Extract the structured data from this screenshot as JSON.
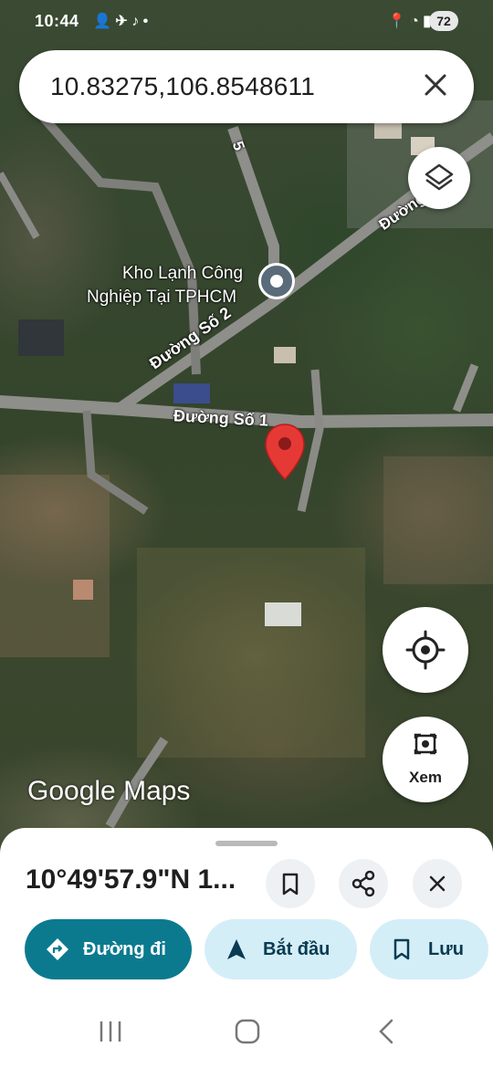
{
  "status_bar": {
    "time": "10:44",
    "battery": "72"
  },
  "search": {
    "query": "10.83275,106.8548611"
  },
  "map": {
    "labels": {
      "poi_name_line1": "Kho Lạnh Công",
      "poi_name_line2": "Nghiệp Tại TPHCM",
      "road_so2": "Đường Số 2",
      "road_so1": "Đường Số 1",
      "road_5": "5",
      "road_top_right": "Đường"
    },
    "attribution": "Google Maps",
    "pin_color": "#e53935"
  },
  "controls": {
    "layers": "layers-icon",
    "my_location": "my-location-icon",
    "lens_label": "Xem"
  },
  "sheet": {
    "coordinates": "10°49'57.9\"N 1...",
    "actions": {
      "directions": "Đường đi",
      "start": "Bắt đầu",
      "save": "Lưu"
    }
  },
  "colors": {
    "accent": "#0b7a8f",
    "pill_light": "#d4eef7"
  }
}
